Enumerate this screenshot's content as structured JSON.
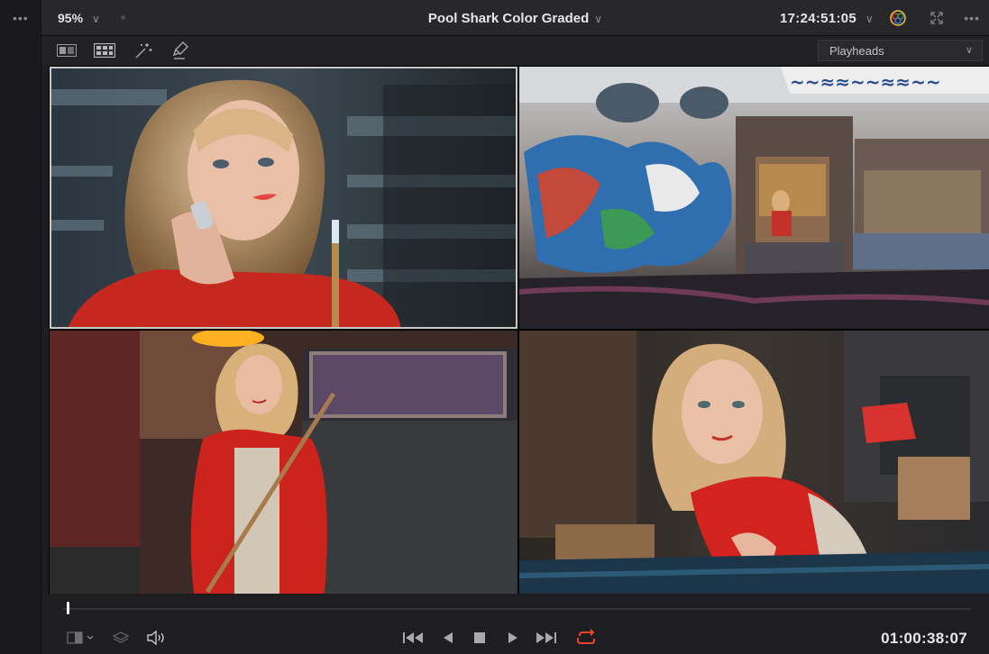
{
  "left_gutter": {
    "menu_icon": "ellipsis-icon"
  },
  "topbar": {
    "zoom_value": "95%",
    "clip_title": "Pool Shark Color Graded",
    "timecode": "17:24:51:05",
    "icons": [
      "color-wheel-icon",
      "fullscreen-icon",
      "ellipsis-icon"
    ]
  },
  "toolbar2": {
    "icons": [
      "single-viewer-icon",
      "split-screen-icon",
      "magic-wand-icon",
      "highlight-pen-icon"
    ],
    "dropdown_value": "Playheads"
  },
  "viewer": {
    "tiles": [
      "woman-on-phone-shot",
      "graffiti-building-shot",
      "woman-with-cue-shot",
      "pool-table-closeup-shot"
    ]
  },
  "transport": {
    "timecode": "01:00:38:07",
    "accent_color": "#e9452d",
    "icons": [
      "viewer-mode-icon",
      "layers-icon",
      "speaker-icon",
      "skip-to-start-icon",
      "play-reverse-icon",
      "stop-icon",
      "play-icon",
      "skip-to-end-icon",
      "loop-icon"
    ]
  }
}
